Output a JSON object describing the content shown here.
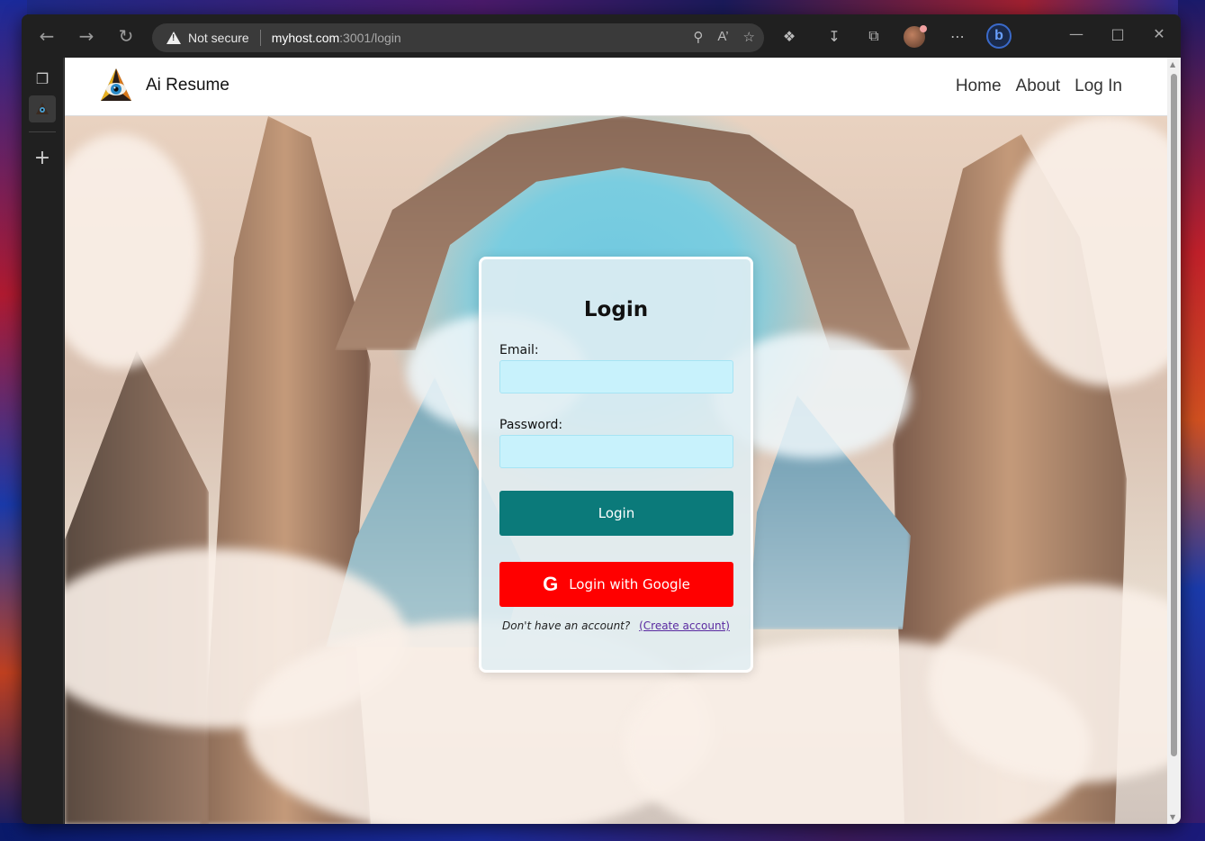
{
  "browser": {
    "security_label": "Not secure",
    "url_host": "myhost.com",
    "url_rest": ":3001/login"
  },
  "site": {
    "brand": "Ai Resume",
    "nav": [
      "Home",
      "About",
      "Log In"
    ]
  },
  "login": {
    "title": "Login",
    "email_label": "Email:",
    "password_label": "Password:",
    "login_button": "Login",
    "google_button": "Login with Google",
    "no_account_text": "Don't have an account?",
    "create_account_link": "(Create account)"
  },
  "colors": {
    "login_button": "#0b7a7a",
    "google_button": "#ff0000",
    "input_bg": "#c8f2fc"
  }
}
